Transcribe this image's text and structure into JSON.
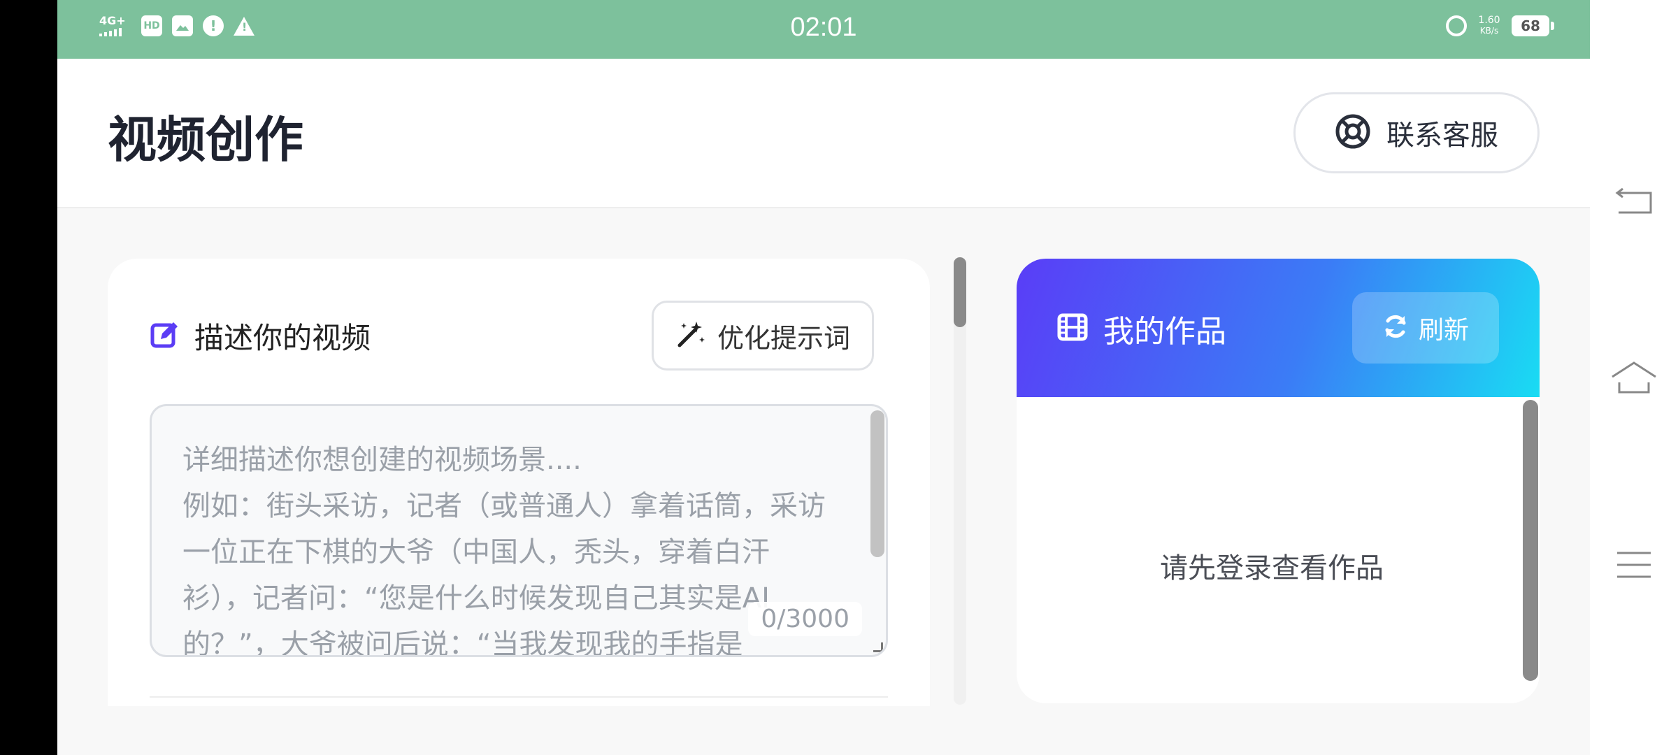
{
  "status_bar": {
    "network": "4G+",
    "hd_badge": "HD",
    "alert_icon": "!",
    "time": "02:01",
    "speed_value": "1.60",
    "speed_unit": "KB/s",
    "battery": "68",
    "icons": [
      "signal-icon",
      "hd-icon",
      "image-icon",
      "alert-circle-icon",
      "warning-triangle-icon",
      "alarm-icon",
      "battery-icon"
    ]
  },
  "header": {
    "title": "视频创作",
    "support_label": "联系客服",
    "support_icon": "lifebuoy-icon"
  },
  "prompt_card": {
    "title": "描述你的视频",
    "title_icon": "edit-icon",
    "optimize_label": "优化提示词",
    "optimize_icon": "magic-wand-icon",
    "placeholder": "详细描述你想创建的视频场景....\n例如：街头采访，记者（或普通人）拿着话筒，采访一位正在下棋的大爷（中国人，秃头，穿着白汗衫），记者问：“您是什么时候发现自己其实是AI的？”，大爷被问后说：“当我发现我的手指是",
    "value": "",
    "counter": "0/3000"
  },
  "works_card": {
    "title": "我的作品",
    "title_icon": "film-icon",
    "refresh_label": "刷新",
    "refresh_icon": "refresh-icon",
    "empty_message": "请先登录查看作品"
  },
  "colors": {
    "status_bar": "#7dc19c",
    "accent_purple": "#5b3df5",
    "gradient_start": "#5a3df7",
    "gradient_end": "#19dcf3"
  }
}
